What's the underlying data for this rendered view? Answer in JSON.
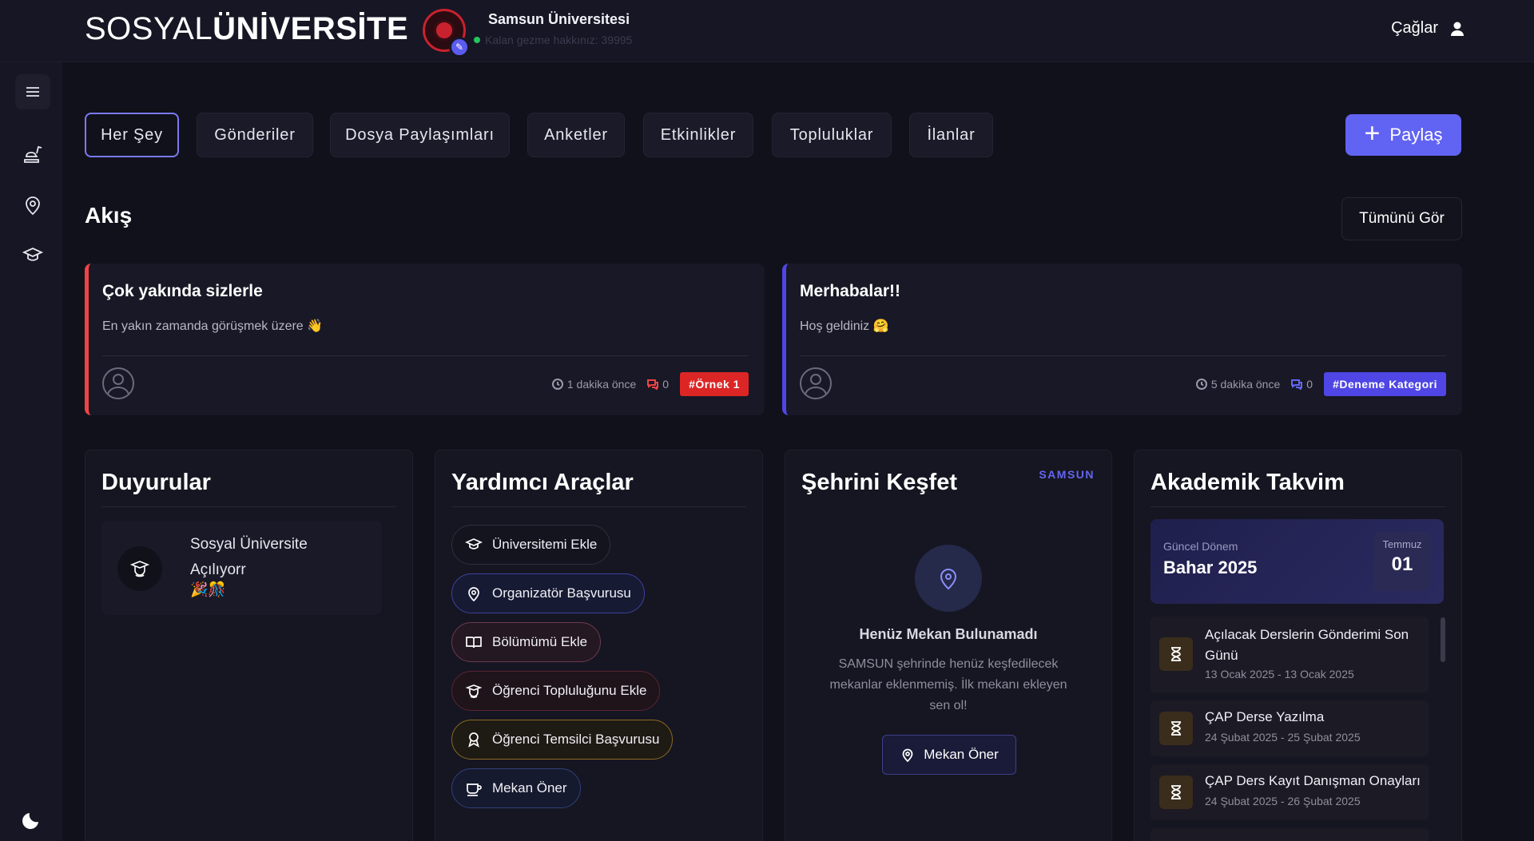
{
  "header": {
    "brand_light": "SOSYAL",
    "brand_bold": "ÜNİVERSİTE",
    "university_name": "Samsun Üniversitesi",
    "switch_info": "Kalan gezme hakkınız: 39995",
    "user_name": "Çağlar"
  },
  "tabs": [
    "Her Şey",
    "Gönderiler",
    "Dosya Paylaşımları",
    "Anketler",
    "Etkinlikler",
    "Topluluklar",
    "İlanlar"
  ],
  "share_label": "Paylaş",
  "feed": {
    "title": "Akış",
    "see_all": "Tümünü Gör",
    "posts": [
      {
        "title": "Çok yakında sizlerle",
        "body": "En yakın zamanda görüşmek üzere 👋",
        "time": "1 dakika önce",
        "comments": "0",
        "tag": "#Örnek 1",
        "tag_color": "#dc2626"
      },
      {
        "title": "Merhabalar!!",
        "body": "Hoş geldiniz 🤗",
        "time": "5 dakika önce",
        "comments": "0",
        "tag": "#Deneme Kategori",
        "tag_color": "#4f46e5"
      }
    ]
  },
  "announcements": {
    "title": "Duyurular",
    "items": [
      {
        "text": "Sosyal Üniversite Açılıyorr",
        "emoji": "🎉🎊"
      }
    ]
  },
  "tools": {
    "title": "Yardımcı Araçlar",
    "items": [
      {
        "label": "Üniversitemi Ekle",
        "icon": "graduation-cap-icon",
        "border": "#2e2e3e"
      },
      {
        "label": "Organizatör Başvurusu",
        "icon": "map-pin-icon",
        "border": "#4040a0"
      },
      {
        "label": "Bölümümü Ekle",
        "icon": "book-open-icon",
        "border": "#6b3a52"
      },
      {
        "label": "Öğrenci Topluluğunu Ekle",
        "icon": "students-icon",
        "border": "#5a2430"
      },
      {
        "label": "Öğrenci Temsilci Başvurusu",
        "icon": "award-icon",
        "border": "#8a6a20"
      },
      {
        "label": "Mekan Öner",
        "icon": "coffee-icon",
        "border": "#30407a"
      }
    ]
  },
  "explore": {
    "title": "Şehrini Keşfet",
    "city": "SAMSUN",
    "empty_title": "Henüz Mekan Bulunamadı",
    "empty_desc": "SAMSUN şehrinde henüz keşfedilecek mekanlar eklenmemiş. İlk mekanı ekleyen sen ol!",
    "button": "Mekan Öner"
  },
  "calendar": {
    "title": "Akademik Takvim",
    "term_label": "Güncel Dönem",
    "term_value": "Bahar 2025",
    "month": "Temmuz",
    "day": "01",
    "events": [
      {
        "title": "Açılacak Derslerin Gönderimi Son Günü",
        "dates": "13 Ocak 2025 - 13 Ocak 2025"
      },
      {
        "title": "ÇAP Derse Yazılma",
        "dates": "24 Şubat 2025 - 25 Şubat 2025"
      },
      {
        "title": "ÇAP Ders Kayıt Danışman Onayları",
        "dates": "24 Şubat 2025 - 26 Şubat 2025"
      }
    ]
  }
}
